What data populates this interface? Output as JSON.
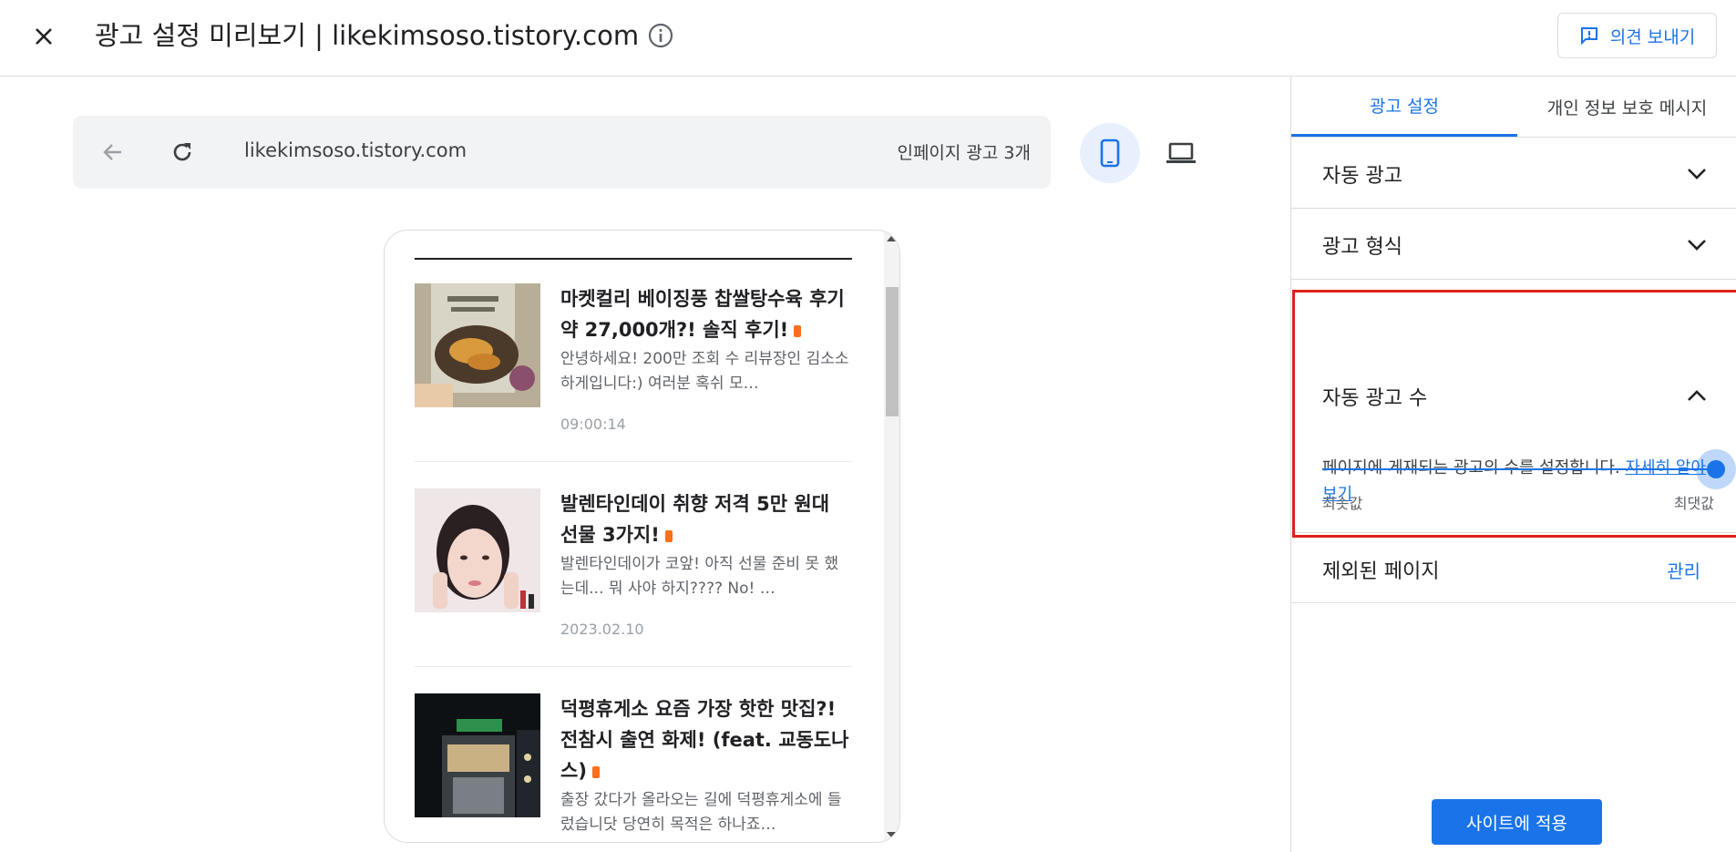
{
  "header": {
    "title": "광고 설정 미리보기 | likekimsoso.tistory.com",
    "feedback_label": "의견 보내기"
  },
  "browser": {
    "url": "likekimsoso.tistory.com",
    "ad_count": "인페이지 광고 3개"
  },
  "posts": [
    {
      "title": "마켓컬리 베이징풍 찹쌀탕수육 후기 약 27,000개?! 솔직 후기!",
      "excerpt": "안녕하세요! 200만 조회 수 리뷰장인 김소소하게입니다:) 여러분 혹쉬 모…",
      "date": "09:00:14"
    },
    {
      "title": "발렌타인데이 취향 저격 5만 원대 선물 3가지!",
      "excerpt": "발렌타인데이가 코앞! 아직 선물 준비 못 했는데... 뭐 사야 하지???? No! …",
      "date": "2023.02.10"
    },
    {
      "title": "덕평휴게소 요즘 가장 핫한 맛집?! 전참시 출연 화제! (feat. 교동도나스)",
      "excerpt": "출장 갔다가 올라오는 길에 덕평휴게소에 들렀습니닷 당연히 목적은 하나죠…",
      "date": ""
    }
  ],
  "panel": {
    "tabs": [
      "광고 설정",
      "개인 정보 보호 메시지"
    ],
    "sections": {
      "auto_ads": "자동 광고",
      "ad_formats": "광고 형식",
      "ad_load": "자동 광고 수",
      "excluded_pages": "제외된 페이지"
    },
    "ad_load_desc": "페이지에 게재되는 광고의 수를 설정합니다.",
    "learn_more": "자세히 알아보기",
    "slider": {
      "min_label": "최솟값",
      "max_label": "최댓값",
      "value": 1.0
    },
    "manage_label": "관리",
    "apply_label": "사이트에 적용"
  },
  "colors": {
    "accent": "#1a73e8",
    "highlight": "#e0201c",
    "badge": "#ff6f1a"
  }
}
